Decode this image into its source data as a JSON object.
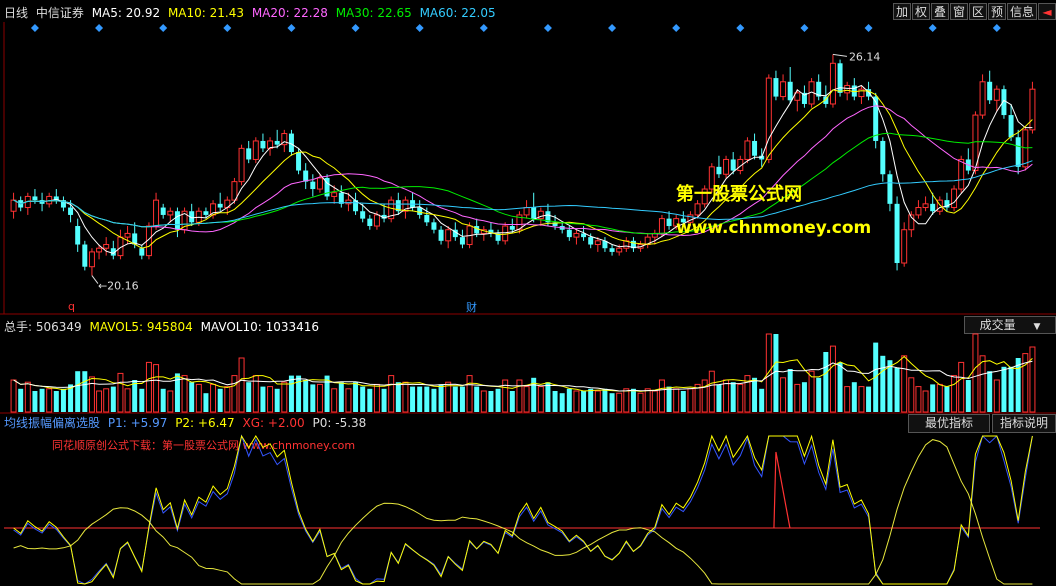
{
  "header": {
    "period": "日线",
    "stock": "中信证券",
    "ma": [
      {
        "label": "MA5: 20.92",
        "color": "#ffffff"
      },
      {
        "label": "MA10: 21.43",
        "color": "#ffff00"
      },
      {
        "label": "MA20: 22.28",
        "color": "#ff66ff"
      },
      {
        "label": "MA30: 22.65",
        "color": "#00ee00"
      },
      {
        "label": "MA60: 22.05",
        "color": "#33ccff"
      }
    ]
  },
  "toolbar": [
    "加",
    "权",
    "叠",
    "窗",
    "区",
    "预",
    "信息",
    "◄"
  ],
  "price": {
    "high_label": "26.14",
    "low_label": "20.16",
    "marker_q": "q",
    "marker_cai": "财",
    "ylim": [
      19.5,
      26.8
    ]
  },
  "volume": {
    "label_total": "总手: 506349",
    "label_mavol5": "MAVOL5: 945804",
    "label_mavol10": "MAVOL10: 1033416",
    "dropdown": "成交量"
  },
  "indicator": {
    "name": "均线振幅偏离选股",
    "p1": "P1: +5.97",
    "p2": "P2: +6.47",
    "xg": "XG: +2.00",
    "p0": "P0: -5.38",
    "note": "同花顺原创公式下载：第一股票公式网 www.chnmoney.com",
    "btn_best": "最优指标",
    "btn_help": "指标说明"
  },
  "watermark": {
    "line1": "第一股票公式网",
    "line2": "www.chnmoney.com"
  },
  "chart_data": {
    "type": "candlestick",
    "ylim": [
      19.5,
      26.8
    ],
    "candles": [
      [
        21.9,
        22.4,
        21.7,
        22.2
      ],
      [
        22.2,
        22.3,
        21.9,
        22.0
      ],
      [
        22.0,
        22.4,
        21.8,
        22.3
      ],
      [
        22.3,
        22.5,
        22.1,
        22.2
      ],
      [
        22.2,
        22.4,
        21.9,
        22.1
      ],
      [
        22.1,
        22.4,
        22.0,
        22.3
      ],
      [
        22.3,
        22.5,
        22.1,
        22.2
      ],
      [
        22.2,
        22.3,
        21.9,
        22.0
      ],
      [
        22.0,
        22.2,
        21.6,
        21.8
      ],
      [
        21.5,
        21.7,
        20.8,
        21.0
      ],
      [
        21.0,
        21.1,
        20.3,
        20.4
      ],
      [
        20.4,
        20.9,
        20.16,
        20.8
      ],
      [
        20.8,
        21.0,
        20.6,
        20.9
      ],
      [
        20.9,
        21.2,
        20.7,
        21.0
      ],
      [
        20.9,
        21.1,
        20.6,
        20.7
      ],
      [
        20.7,
        21.4,
        20.6,
        21.2
      ],
      [
        21.2,
        21.5,
        21.0,
        21.3
      ],
      [
        21.3,
        21.6,
        20.9,
        21.0
      ],
      [
        20.9,
        21.0,
        20.6,
        20.7
      ],
      [
        20.7,
        21.6,
        20.6,
        21.5
      ],
      [
        21.5,
        22.4,
        21.4,
        22.2
      ],
      [
        22.0,
        22.1,
        21.7,
        21.8
      ],
      [
        21.8,
        22.0,
        21.6,
        21.9
      ],
      [
        21.9,
        22.0,
        21.2,
        21.4
      ],
      [
        21.4,
        22.0,
        21.3,
        21.9
      ],
      [
        21.9,
        22.1,
        21.5,
        21.6
      ],
      [
        21.6,
        22.0,
        21.5,
        21.9
      ],
      [
        21.9,
        22.0,
        21.7,
        21.8
      ],
      [
        21.8,
        22.2,
        21.7,
        22.1
      ],
      [
        22.1,
        22.4,
        21.9,
        22.0
      ],
      [
        22.0,
        22.3,
        21.8,
        22.2
      ],
      [
        22.2,
        22.8,
        22.1,
        22.7
      ],
      [
        22.7,
        23.7,
        22.6,
        23.6
      ],
      [
        23.6,
        23.8,
        23.2,
        23.3
      ],
      [
        23.3,
        23.9,
        23.2,
        23.8
      ],
      [
        23.8,
        24.0,
        23.5,
        23.6
      ],
      [
        23.6,
        23.9,
        23.4,
        23.8
      ],
      [
        23.8,
        24.1,
        23.6,
        23.7
      ],
      [
        23.7,
        24.1,
        23.5,
        24.0
      ],
      [
        24.0,
        24.1,
        23.4,
        23.5
      ],
      [
        23.5,
        23.6,
        22.9,
        23.0
      ],
      [
        23.0,
        23.2,
        22.5,
        22.7
      ],
      [
        22.7,
        22.9,
        22.3,
        22.5
      ],
      [
        22.5,
        22.9,
        22.4,
        22.8
      ],
      [
        22.8,
        22.9,
        22.2,
        22.3
      ],
      [
        22.3,
        22.6,
        22.1,
        22.4
      ],
      [
        22.4,
        22.6,
        22.0,
        22.1
      ],
      [
        22.1,
        22.4,
        21.9,
        22.2
      ],
      [
        22.2,
        22.4,
        21.8,
        21.9
      ],
      [
        21.9,
        22.1,
        21.6,
        21.7
      ],
      [
        21.7,
        21.8,
        21.4,
        21.5
      ],
      [
        21.5,
        21.9,
        21.4,
        21.8
      ],
      [
        21.8,
        22.1,
        21.6,
        21.7
      ],
      [
        21.7,
        22.3,
        21.6,
        22.2
      ],
      [
        22.2,
        22.4,
        21.8,
        21.9
      ],
      [
        21.9,
        22.3,
        21.7,
        22.2
      ],
      [
        22.2,
        22.4,
        21.9,
        22.0
      ],
      [
        22.0,
        22.2,
        21.7,
        21.8
      ],
      [
        21.8,
        22.0,
        21.5,
        21.6
      ],
      [
        21.6,
        21.7,
        21.3,
        21.4
      ],
      [
        21.4,
        21.5,
        21.0,
        21.1
      ],
      [
        21.1,
        21.5,
        20.9,
        21.4
      ],
      [
        21.4,
        21.6,
        21.1,
        21.2
      ],
      [
        21.2,
        21.4,
        20.9,
        21.0
      ],
      [
        21.0,
        21.6,
        20.9,
        21.5
      ],
      [
        21.5,
        21.7,
        21.2,
        21.3
      ],
      [
        21.3,
        21.5,
        21.1,
        21.4
      ],
      [
        21.4,
        21.6,
        21.2,
        21.3
      ],
      [
        21.3,
        21.4,
        21.0,
        21.1
      ],
      [
        21.1,
        21.6,
        21.0,
        21.5
      ],
      [
        21.5,
        21.7,
        21.3,
        21.4
      ],
      [
        21.4,
        21.9,
        21.3,
        21.8
      ],
      [
        21.8,
        22.2,
        21.7,
        22.0
      ],
      [
        22.0,
        22.4,
        21.6,
        21.7
      ],
      [
        21.7,
        22.0,
        21.5,
        21.9
      ],
      [
        21.9,
        22.1,
        21.5,
        21.6
      ],
      [
        21.6,
        21.8,
        21.4,
        21.5
      ],
      [
        21.5,
        21.6,
        21.3,
        21.4
      ],
      [
        21.4,
        21.5,
        21.1,
        21.2
      ],
      [
        21.2,
        21.4,
        21.0,
        21.3
      ],
      [
        21.3,
        21.5,
        21.1,
        21.2
      ],
      [
        21.2,
        21.3,
        20.9,
        21.0
      ],
      [
        21.0,
        21.2,
        20.8,
        21.1
      ],
      [
        21.1,
        21.2,
        20.8,
        20.9
      ],
      [
        20.9,
        21.0,
        20.7,
        20.8
      ],
      [
        20.8,
        21.0,
        20.7,
        20.9
      ],
      [
        20.9,
        21.2,
        20.8,
        21.1
      ],
      [
        21.1,
        21.2,
        20.8,
        20.9
      ],
      [
        20.9,
        21.1,
        20.8,
        21.0
      ],
      [
        21.0,
        21.3,
        20.9,
        21.2
      ],
      [
        21.2,
        21.4,
        21.0,
        21.3
      ],
      [
        21.3,
        21.8,
        21.2,
        21.7
      ],
      [
        21.7,
        21.9,
        21.4,
        21.5
      ],
      [
        21.5,
        21.8,
        21.4,
        21.7
      ],
      [
        21.7,
        21.9,
        21.5,
        21.6
      ],
      [
        21.6,
        21.9,
        21.5,
        21.8
      ],
      [
        21.8,
        22.2,
        21.7,
        22.1
      ],
      [
        22.1,
        22.6,
        22.0,
        22.5
      ],
      [
        22.5,
        23.2,
        22.4,
        23.1
      ],
      [
        23.1,
        23.4,
        22.8,
        22.9
      ],
      [
        22.9,
        23.4,
        22.8,
        23.3
      ],
      [
        23.3,
        23.5,
        22.9,
        23.0
      ],
      [
        23.0,
        23.4,
        22.9,
        23.3
      ],
      [
        23.3,
        23.9,
        23.2,
        23.8
      ],
      [
        23.8,
        24.0,
        23.3,
        23.4
      ],
      [
        23.4,
        23.6,
        23.1,
        23.3
      ],
      [
        23.3,
        25.6,
        23.2,
        25.5
      ],
      [
        25.5,
        25.7,
        24.9,
        25.0
      ],
      [
        25.0,
        25.6,
        24.9,
        25.4
      ],
      [
        25.4,
        25.8,
        24.8,
        24.9
      ],
      [
        24.9,
        25.2,
        24.6,
        25.1
      ],
      [
        25.1,
        25.3,
        24.7,
        24.8
      ],
      [
        24.8,
        25.5,
        24.7,
        25.4
      ],
      [
        25.4,
        25.6,
        24.9,
        25.0
      ],
      [
        25.0,
        25.3,
        24.7,
        24.8
      ],
      [
        24.8,
        26.14,
        24.7,
        25.9
      ],
      [
        25.9,
        26.0,
        25.0,
        25.1
      ],
      [
        25.1,
        25.4,
        24.9,
        25.3
      ],
      [
        25.3,
        25.5,
        24.9,
        25.0
      ],
      [
        25.0,
        25.3,
        24.8,
        25.2
      ],
      [
        25.2,
        25.4,
        24.9,
        25.0
      ],
      [
        25.0,
        25.1,
        23.6,
        23.8
      ],
      [
        23.8,
        23.9,
        22.7,
        22.9
      ],
      [
        22.9,
        23.0,
        21.9,
        22.1
      ],
      [
        22.1,
        22.3,
        20.3,
        20.5
      ],
      [
        20.5,
        21.6,
        20.4,
        21.4
      ],
      [
        21.4,
        21.9,
        21.2,
        21.8
      ],
      [
        21.8,
        22.2,
        21.7,
        22.0
      ],
      [
        22.0,
        22.3,
        21.9,
        22.1
      ],
      [
        22.1,
        22.4,
        21.8,
        21.9
      ],
      [
        21.9,
        22.3,
        21.8,
        22.2
      ],
      [
        22.2,
        22.4,
        21.9,
        22.0
      ],
      [
        22.0,
        22.6,
        21.9,
        22.5
      ],
      [
        22.5,
        23.4,
        22.4,
        23.3
      ],
      [
        23.3,
        23.6,
        22.9,
        23.0
      ],
      [
        23.0,
        24.6,
        22.9,
        24.5
      ],
      [
        24.5,
        25.6,
        24.4,
        25.4
      ],
      [
        25.4,
        25.7,
        24.8,
        24.9
      ],
      [
        24.9,
        25.3,
        24.6,
        25.2
      ],
      [
        25.2,
        25.3,
        24.4,
        24.5
      ],
      [
        24.5,
        24.8,
        23.8,
        23.9
      ],
      [
        23.9,
        24.1,
        22.9,
        23.1
      ],
      [
        23.1,
        24.2,
        23.0,
        24.1
      ],
      [
        24.1,
        25.4,
        24.0,
        25.2
      ]
    ]
  }
}
